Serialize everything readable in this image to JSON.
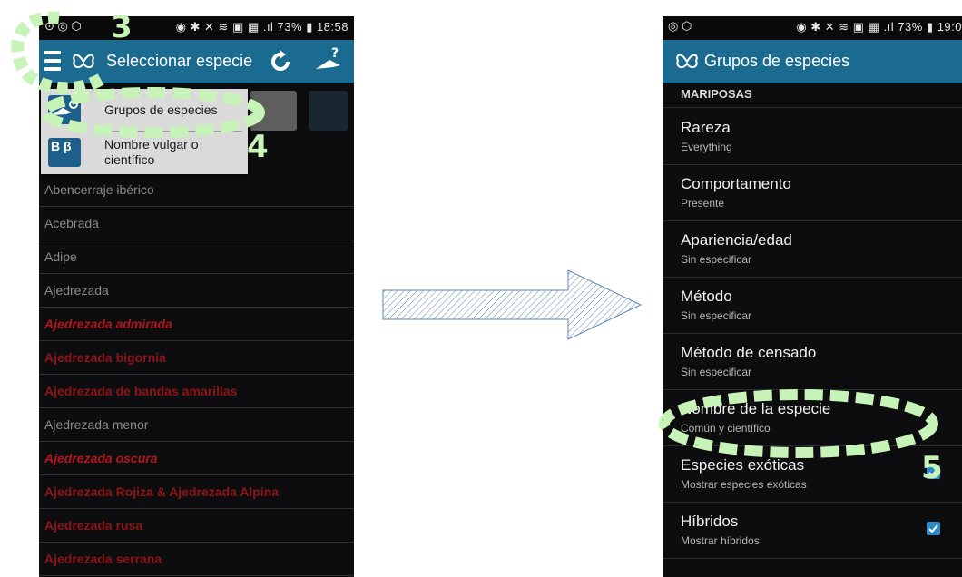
{
  "left": {
    "status": {
      "left_icons": "⊙ ◎ ⬡",
      "right": "◉ ✱ ✕ ≋ ▣ ▦ .ıl 73% ▮ 18:58"
    },
    "appbar": {
      "title": "Seleccionar especie"
    },
    "popup": {
      "items": [
        "Grupos de especies",
        "Nombre vulgar o científico"
      ],
      "icon_bb": "B β"
    },
    "rows": [
      {
        "label": "Abencerraje ibérico",
        "style": "normal"
      },
      {
        "label": "Acebrada",
        "style": "normal"
      },
      {
        "label": "Adipe",
        "style": "normal"
      },
      {
        "label": "Ajedrezada",
        "style": "normal"
      },
      {
        "label": "Ajedrezada admirada",
        "style": "red"
      },
      {
        "label": "Ajedrezada bigornia",
        "style": "red2"
      },
      {
        "label": "Ajedrezada de bandas amarillas",
        "style": "red2"
      },
      {
        "label": "Ajedrezada menor",
        "style": "normal"
      },
      {
        "label": "Ajedrezada oscura",
        "style": "red"
      },
      {
        "label": "Ajedrezada Rojiza & Ajedrezada Alpina",
        "style": "red2"
      },
      {
        "label": "Ajedrezada rusa",
        "style": "red2"
      },
      {
        "label": "Ajedrezada serrana",
        "style": "red2"
      }
    ]
  },
  "right": {
    "status": {
      "left_icons": "◎ ⬡",
      "right": "◉ ✱ ✕ ≋ ▣ ▦ .ıl 73% ▮ 19:0"
    },
    "appbar": {
      "title": "Grupos de especies"
    },
    "section": "MARIPOSAS",
    "settings": [
      {
        "title": "Rareza",
        "subtitle": "Everything",
        "checked": false
      },
      {
        "title": "Comportamento",
        "subtitle": "Presente",
        "checked": false
      },
      {
        "title": "Apariencia/edad",
        "subtitle": "Sin especificar",
        "checked": false
      },
      {
        "title": "Método",
        "subtitle": "Sin especificar",
        "checked": false
      },
      {
        "title": "Método de censado",
        "subtitle": "Sin especificar",
        "checked": false
      },
      {
        "title": "Nombre de la especie",
        "subtitle": "Común y científico",
        "checked": false
      },
      {
        "title": "Especies exóticas",
        "subtitle": "Mostrar especies exóticas",
        "checked": true
      },
      {
        "title": "Híbridos",
        "subtitle": "Mostrar híbridos",
        "checked": true
      }
    ]
  },
  "annotations": {
    "n3": "3",
    "n4": "4",
    "n5": "5"
  },
  "colors": {
    "appbar": "#1b6a8f",
    "highlight": "#c7f2b8",
    "red_text": "#b0171a",
    "checkbox": "#2d8ac9"
  }
}
